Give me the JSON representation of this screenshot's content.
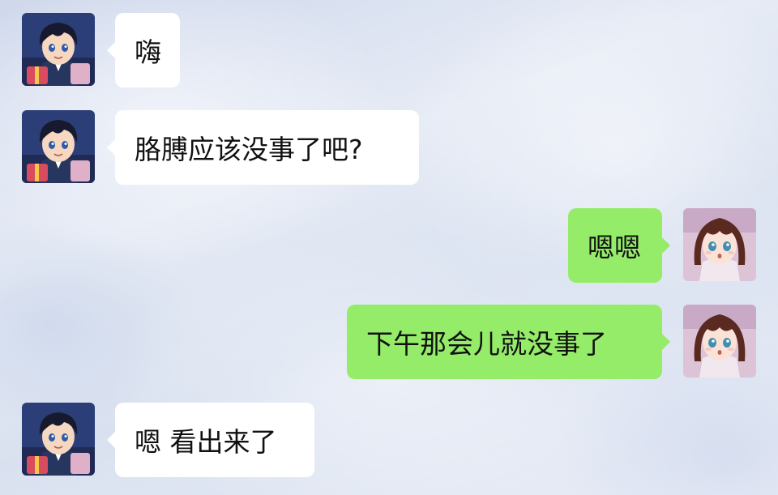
{
  "messages": [
    {
      "side": "left",
      "text": "嗨"
    },
    {
      "side": "left",
      "text": "胳膊应该没事了吧?"
    },
    {
      "side": "right",
      "text": "嗯嗯"
    },
    {
      "side": "right",
      "text": "下午那会儿就没事了"
    },
    {
      "side": "left",
      "text": "嗯 看出来了"
    }
  ],
  "colors": {
    "incoming_bubble": "#ffffff",
    "outgoing_bubble": "#95ec69",
    "text": "#111111"
  },
  "icons": {
    "incoming_avatar": "boy-avatar-icon",
    "outgoing_avatar": "girl-avatar-icon"
  }
}
